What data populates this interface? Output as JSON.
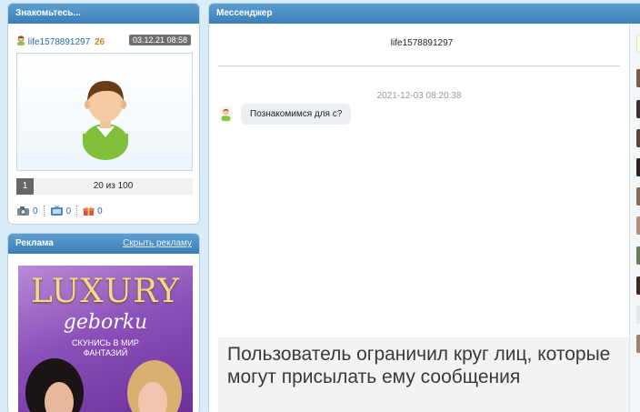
{
  "left_panel": {
    "title": "Знакомьтесь...",
    "user_name": "life1578891297",
    "user_age": "26",
    "date": "03.12.21 08:58",
    "pager": {
      "current": "1",
      "count_text": "20 из 100"
    },
    "stats": [
      {
        "icon": "camera-icon",
        "value": "0"
      },
      {
        "icon": "tv-icon",
        "value": "0"
      },
      {
        "icon": "gift-icon",
        "value": "0"
      }
    ]
  },
  "ad_panel": {
    "title": "Реклама",
    "hide_link": "Скрыть рекламу",
    "ad_title": "LUXURY",
    "ad_subtitle": "geborku",
    "ad_line1": "СКУНИСЬ В МИР",
    "ad_line2": "ФАНТАЗИЙ"
  },
  "messenger": {
    "title": "Мессенджер",
    "chat_user": "life1578891297",
    "message_time": "2021-12-03 08:20:38",
    "message_text": "Познакомимся для с?",
    "restriction_text": "Пользователь ограничил круг лиц, которые могут присылать ему сообщения"
  },
  "colors": {
    "header_blue": "#3b7fb8",
    "link_blue": "#2d6ea8",
    "age_orange": "#d08a1a",
    "avatar_green": "#8bc34a"
  }
}
